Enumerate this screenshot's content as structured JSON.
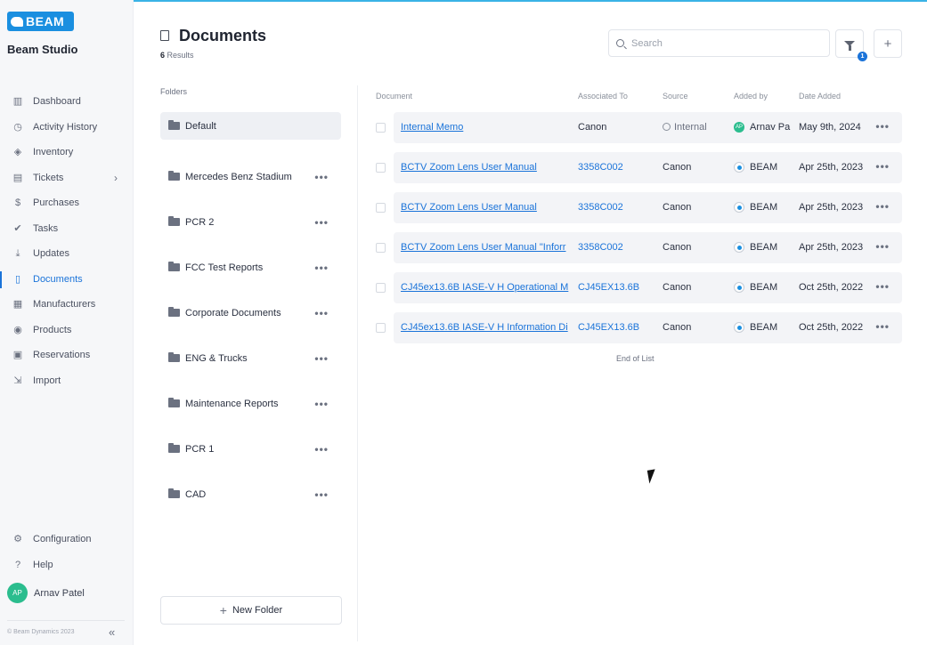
{
  "app": {
    "logo_text": "BEAM",
    "org_name": "Beam Studio",
    "accent": "#1a73d9"
  },
  "sidebar": {
    "items": [
      {
        "label": "Dashboard",
        "icon": "chart-icon"
      },
      {
        "label": "Activity History",
        "icon": "history-icon"
      },
      {
        "label": "Inventory",
        "icon": "box-icon"
      },
      {
        "label": "Tickets",
        "icon": "ticket-icon"
      },
      {
        "label": "Purchases",
        "icon": "dollar-icon"
      },
      {
        "label": "Tasks",
        "icon": "check-circle-icon"
      },
      {
        "label": "Updates",
        "icon": "download-icon"
      },
      {
        "label": "Documents",
        "icon": "document-icon"
      },
      {
        "label": "Manufacturers",
        "icon": "building-icon"
      },
      {
        "label": "Products",
        "icon": "camera-icon"
      },
      {
        "label": "Reservations",
        "icon": "calendar-icon"
      },
      {
        "label": "Import",
        "icon": "import-icon"
      }
    ],
    "bottom": [
      {
        "label": "Configuration",
        "icon": "gear-icon"
      },
      {
        "label": "Help",
        "icon": "help-icon"
      }
    ],
    "user": {
      "initials": "AP",
      "name": "Arnav Patel"
    },
    "copyright": "© Beam Dynamics 2023"
  },
  "header": {
    "title": "Documents",
    "results_count": "6",
    "results_label": "Results",
    "search_placeholder": "Search",
    "filter_badge": "1"
  },
  "folders": {
    "label": "Folders",
    "items": [
      {
        "name": "Default"
      },
      {
        "name": "Mercedes Benz Stadium"
      },
      {
        "name": "PCR 2"
      },
      {
        "name": "FCC Test Reports"
      },
      {
        "name": "Corporate Documents"
      },
      {
        "name": "ENG & Trucks"
      },
      {
        "name": "Maintenance Reports"
      },
      {
        "name": "PCR 1"
      },
      {
        "name": "CAD"
      }
    ],
    "new_folder_label": "New Folder"
  },
  "table": {
    "headers": {
      "document": "Document",
      "associated": "Associated To",
      "source": "Source",
      "added_by": "Added by",
      "date": "Date Added"
    },
    "rows": [
      {
        "document": "Internal Memo",
        "associated": "Canon",
        "source": "Internal",
        "added_by": "Arnav Pa",
        "date": "May 9th, 2024"
      },
      {
        "document": "BCTV Zoom Lens User Manual",
        "associated": "3358C002",
        "source": "Canon",
        "added_by": "BEAM",
        "date": "Apr 25th, 2023"
      },
      {
        "document": "BCTV Zoom Lens User Manual",
        "associated": "3358C002",
        "source": "Canon",
        "added_by": "BEAM",
        "date": "Apr 25th, 2023"
      },
      {
        "document": "BCTV Zoom Lens User Manual \"Inforr",
        "associated": "3358C002",
        "source": "Canon",
        "added_by": "BEAM",
        "date": "Apr 25th, 2023"
      },
      {
        "document": "CJ45ex13.6B IASE-V H Operational M",
        "associated": "CJ45EX13.6B",
        "source": "Canon",
        "added_by": "BEAM",
        "date": "Oct 25th, 2022"
      },
      {
        "document": "CJ45ex13.6B IASE-V H Information Di",
        "associated": "CJ45EX13.6B",
        "source": "Canon",
        "added_by": "BEAM",
        "date": "Oct 25th, 2022"
      }
    ],
    "end_label": "End of List"
  }
}
